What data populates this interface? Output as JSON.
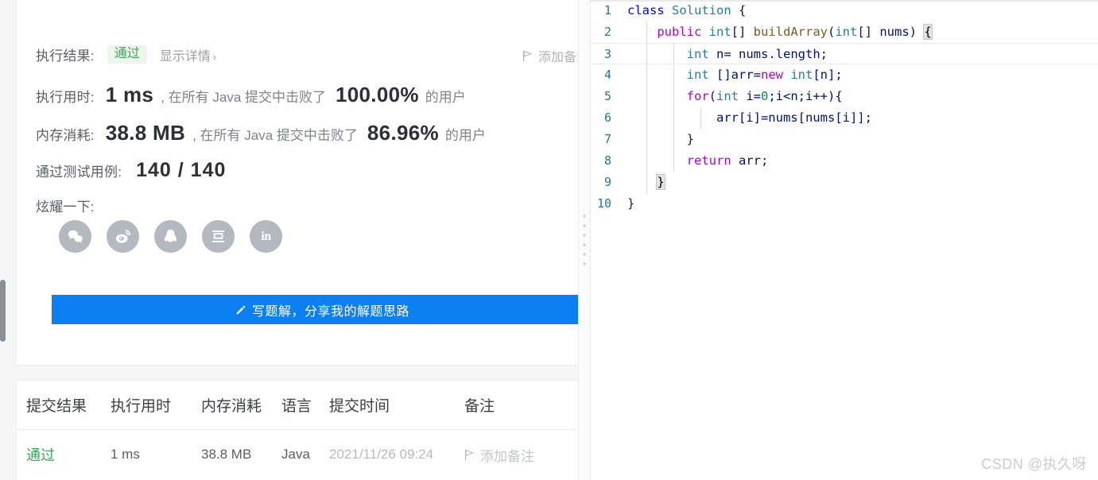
{
  "result_panel": {
    "result_label": "执行结果:",
    "result_badge": "通过",
    "show_detail": "显示详情",
    "show_detail_chevron": "›",
    "runtime_label": "执行用时:",
    "runtime_value": "1 ms",
    "runtime_mid": ", 在所有 Java 提交中击败了",
    "runtime_pct": "100.00%",
    "runtime_tail": "的用户",
    "memory_label": "内存消耗:",
    "memory_value": "38.8 MB",
    "memory_mid": ", 在所有 Java 提交中击败了",
    "memory_pct": "86.96%",
    "memory_tail": "的用户",
    "testcase_label": "通过测试用例:",
    "testcase_value": "140 / 140",
    "share_label": "炫耀一下:",
    "add_note": "添加备注",
    "write_solution_button": "写题解，分享我的解题思路",
    "social_icons": [
      {
        "name": "wechat-icon",
        "label": "微信"
      },
      {
        "name": "weibo-icon",
        "label": "微博"
      },
      {
        "name": "qq-icon",
        "label": "QQ"
      },
      {
        "name": "douban-icon",
        "label": "豆瓣"
      },
      {
        "name": "linkedin-icon",
        "label": "LinkedIn"
      }
    ]
  },
  "submissions_table": {
    "headers": [
      "提交结果",
      "执行用时",
      "内存消耗",
      "语言",
      "提交时间",
      "",
      "备注"
    ],
    "rows": [
      {
        "result": "通过",
        "runtime": "1 ms",
        "memory": "38.8 MB",
        "language": "Java",
        "time": "2021/11/26 09:24",
        "note": "添加备注"
      }
    ]
  },
  "editor": {
    "language": "java",
    "lines": [
      {
        "num": "1",
        "active": false,
        "guides": 0,
        "tokens": [
          {
            "t": "class",
            "c": "k-kw"
          },
          {
            "t": " ",
            "c": "k-plain"
          },
          {
            "t": "Solution",
            "c": "k-cls"
          },
          {
            "t": " ",
            "c": "k-plain"
          },
          {
            "t": "{",
            "c": "k-punc"
          }
        ]
      },
      {
        "num": "2",
        "active": false,
        "guides": 1,
        "tokens": [
          {
            "t": "    ",
            "c": "k-plain"
          },
          {
            "t": "public",
            "c": "k-kw2"
          },
          {
            "t": " ",
            "c": "k-plain"
          },
          {
            "t": "int",
            "c": "k-type"
          },
          {
            "t": "[] ",
            "c": "k-punc"
          },
          {
            "t": "buildArray",
            "c": "k-fn"
          },
          {
            "t": "(",
            "c": "k-punc"
          },
          {
            "t": "int",
            "c": "k-type"
          },
          {
            "t": "[] ",
            "c": "k-punc"
          },
          {
            "t": "nums",
            "c": "k-var"
          },
          {
            "t": ") ",
            "c": "k-punc"
          },
          {
            "t": "{",
            "c": "brace-match"
          }
        ]
      },
      {
        "num": "3",
        "active": true,
        "guides": 2,
        "tokens": [
          {
            "t": "        ",
            "c": "k-plain"
          },
          {
            "t": "int",
            "c": "k-type"
          },
          {
            "t": " n= nums",
            "c": "k-var"
          },
          {
            "t": ".",
            "c": "k-punc"
          },
          {
            "t": "length",
            "c": "k-var"
          },
          {
            "t": ";",
            "c": "k-punc"
          }
        ]
      },
      {
        "num": "4",
        "active": false,
        "guides": 2,
        "tokens": [
          {
            "t": "        ",
            "c": "k-plain"
          },
          {
            "t": "int",
            "c": "k-type"
          },
          {
            "t": " []arr=",
            "c": "k-var"
          },
          {
            "t": "new",
            "c": "k-kw2"
          },
          {
            "t": " ",
            "c": "k-plain"
          },
          {
            "t": "int",
            "c": "k-type"
          },
          {
            "t": "[n];",
            "c": "k-var"
          }
        ]
      },
      {
        "num": "5",
        "active": false,
        "guides": 2,
        "tokens": [
          {
            "t": "        ",
            "c": "k-plain"
          },
          {
            "t": "for",
            "c": "k-kw2"
          },
          {
            "t": "(",
            "c": "k-punc"
          },
          {
            "t": "int",
            "c": "k-type"
          },
          {
            "t": " i=",
            "c": "k-var"
          },
          {
            "t": "0",
            "c": "k-num"
          },
          {
            "t": ";i<n;i++){",
            "c": "k-var"
          }
        ]
      },
      {
        "num": "6",
        "active": false,
        "guides": 3,
        "tokens": [
          {
            "t": "            arr[i]=nums[nums[i]];",
            "c": "k-var"
          }
        ]
      },
      {
        "num": "7",
        "active": false,
        "guides": 2,
        "tokens": [
          {
            "t": "        }",
            "c": "k-punc"
          }
        ]
      },
      {
        "num": "8",
        "active": false,
        "guides": 2,
        "tokens": [
          {
            "t": "        ",
            "c": "k-plain"
          },
          {
            "t": "return",
            "c": "k-kw2"
          },
          {
            "t": " arr",
            "c": "k-var"
          },
          {
            "t": ";",
            "c": "k-punc"
          }
        ]
      },
      {
        "num": "9",
        "active": false,
        "guides": 1,
        "tokens": [
          {
            "t": "    ",
            "c": "k-plain"
          },
          {
            "t": "}",
            "c": "brace-match"
          }
        ]
      },
      {
        "num": "10",
        "active": false,
        "guides": 0,
        "tokens": [
          {
            "t": "}",
            "c": "k-punc"
          }
        ]
      }
    ]
  },
  "watermark": "CSDN @执久呀",
  "colors": {
    "accent_blue": "#0c7ff2",
    "pass_green": "#3aa757",
    "badge_bg": "#eef6ec",
    "page_bg": "#f5f6f7",
    "card_bg": "#ffffff"
  }
}
